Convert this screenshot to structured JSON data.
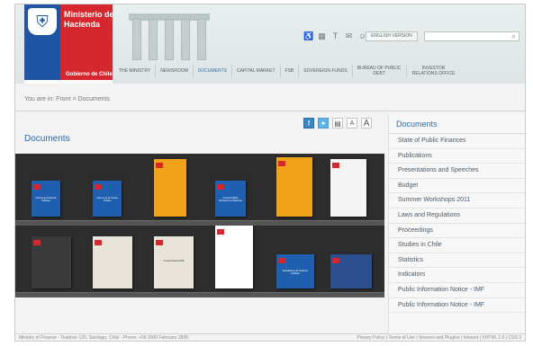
{
  "header": {
    "ministry_name": "Ministerio de Hacienda",
    "gov_label": "Gobierno de Chile",
    "english_version": "ENGLISH VERSION",
    "search_placeholder": ""
  },
  "nav": [
    {
      "label": "THE MINISTRY"
    },
    {
      "label": "NEWSROOM"
    },
    {
      "label": "DOCUMENTS"
    },
    {
      "label": "CAPITAL MARKET"
    },
    {
      "label": "FSB"
    },
    {
      "label": "SOVEREIGN FUNDS"
    },
    {
      "label": "BUREAU OF PUBLIC DEBT"
    },
    {
      "label": "INVESTOR RELATIONS OFFICE"
    }
  ],
  "breadcrumb": {
    "prefix": "You are in:",
    "front": "Front",
    "separator": ">",
    "current": "Documents"
  },
  "main": {
    "title": "Documents",
    "font_small": "A",
    "font_large": "A"
  },
  "books": [
    {
      "title": "Informe de Finanzas Públicas",
      "color": "#1f5fb0"
    },
    {
      "title": "Informe de la Cuenta Pública",
      "color": "#1f5fb0"
    },
    {
      "title": "",
      "color": "#f1a216"
    },
    {
      "title": "Cuenta Pública Ministerio de Hacienda",
      "color": "#1f5fb0"
    },
    {
      "title": "",
      "color": "#f1a216"
    },
    {
      "title": "",
      "color": "#f4f4f4"
    },
    {
      "title": "",
      "color": "#3a3a3a"
    },
    {
      "title": "",
      "color": "#e8e4da"
    },
    {
      "title": "Cuenta Pública 2006",
      "color": "#e8e4da"
    },
    {
      "title": "",
      "color": "#ffffff"
    },
    {
      "title": "Estadísticas de Finanzas Públicas",
      "color": "#1f5fb0"
    },
    {
      "title": "",
      "color": "#2c4f8f"
    }
  ],
  "sidebar": {
    "title": "Documents",
    "items": [
      {
        "label": "State of Public Finances"
      },
      {
        "label": "Publications"
      },
      {
        "label": "Presentations and Speeches"
      },
      {
        "label": "Budget"
      },
      {
        "label": "Summer Workshops 2011"
      },
      {
        "label": "Laws and Regulations"
      },
      {
        "label": "Proceedings"
      },
      {
        "label": "Studies in Chile"
      },
      {
        "label": "Statistics"
      },
      {
        "label": "Indicators"
      },
      {
        "label": "Public Information Notice - IMF"
      },
      {
        "label": "Public Information Notice - IMF"
      }
    ]
  },
  "footer": {
    "address": "Ministry of Finance - Teatinos 120, Santiago, Chile - Phone: +56 2000 February 2828",
    "links": "Privacy Policy | Terms of Use | Viewers and Plugins | Intranet | XHTML 1.0 | CSS 3"
  },
  "colors": {
    "accent": "#2b69a8",
    "logo_blue": "#1f55a3",
    "logo_red": "#d6262e"
  }
}
